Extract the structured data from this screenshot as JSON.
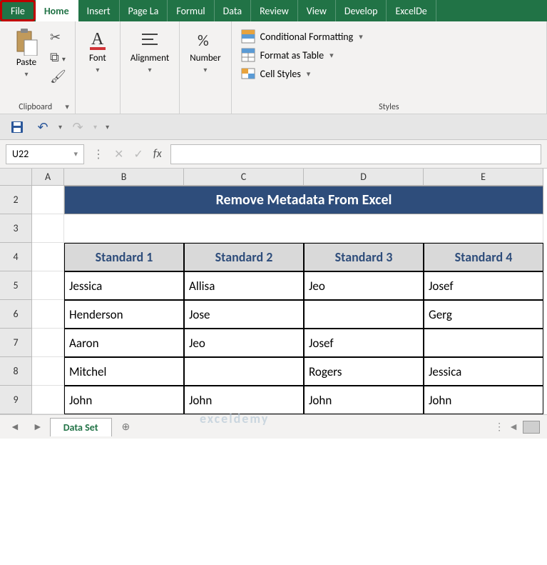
{
  "tabs": {
    "file": "File",
    "home": "Home",
    "insert": "Insert",
    "pagelayout": "Page La",
    "formulas": "Formul",
    "data": "Data",
    "review": "Review",
    "view": "View",
    "developer": "Develop",
    "exceldemy": "ExcelDe"
  },
  "ribbon": {
    "clipboard": {
      "paste": "Paste",
      "label": "Clipboard"
    },
    "font": {
      "btn": "Font",
      "label": ""
    },
    "alignment": {
      "btn": "Alignment",
      "label": ""
    },
    "number": {
      "btn": "Number",
      "label": ""
    },
    "styles": {
      "cond": "Conditional Formatting",
      "table": "Format as Table",
      "cell": "Cell Styles",
      "label": "Styles"
    }
  },
  "namebox": "U22",
  "fx_label": "fx",
  "columns": [
    "A",
    "B",
    "C",
    "D",
    "E"
  ],
  "row_labels": [
    "2",
    "3",
    "4",
    "5",
    "6",
    "7",
    "8",
    "9"
  ],
  "title": "Remove Metadata From Excel",
  "headers": [
    "Standard 1",
    "Standard 2",
    "Standard 3",
    "Standard 4"
  ],
  "table": [
    [
      "Jessica",
      "Allisa",
      "Jeo",
      "Josef"
    ],
    [
      "Henderson",
      "Jose",
      "",
      "Gerg"
    ],
    [
      "Aaron",
      "Jeo",
      "Josef",
      ""
    ],
    [
      "Mitchel",
      "",
      "Rogers",
      "Jessica"
    ],
    [
      "John",
      "John",
      "John",
      "John"
    ]
  ],
  "sheet": {
    "name": "Data Set"
  },
  "watermark": "exceldemy"
}
